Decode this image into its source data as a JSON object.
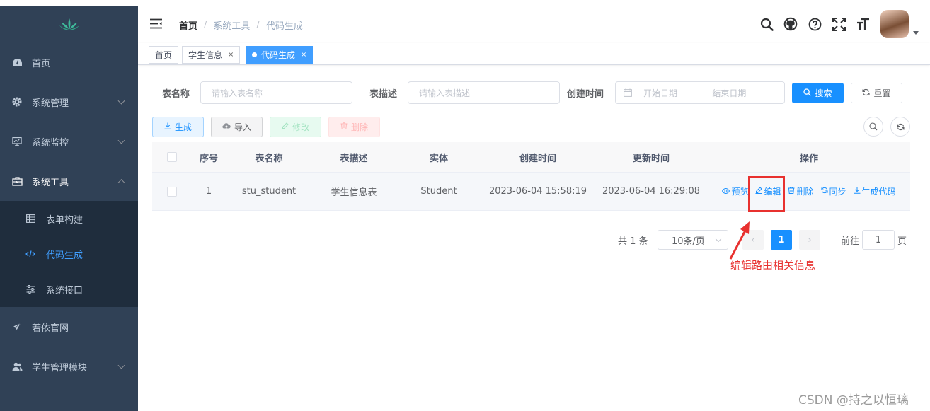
{
  "sidebar": {
    "logo_icon": "lotus-logo-icon",
    "items": [
      {
        "label": "首页",
        "icon": "dashboard-icon"
      },
      {
        "label": "系统管理",
        "icon": "gear-icon"
      },
      {
        "label": "系统监控",
        "icon": "monitor-icon"
      },
      {
        "label": "系统工具",
        "icon": "toolbox-icon"
      },
      {
        "label": "若依官网",
        "icon": "paper-plane-icon"
      },
      {
        "label": "学生管理模块",
        "icon": "users-icon"
      }
    ],
    "submenu": [
      {
        "label": "表单构建",
        "icon": "form-grid-icon"
      },
      {
        "label": "代码生成",
        "icon": "code-icon",
        "active": true
      },
      {
        "label": "系统接口",
        "icon": "sliders-icon"
      }
    ]
  },
  "breadcrumb": [
    "首页",
    "系统工具",
    "代码生成"
  ],
  "tags": [
    {
      "label": "首页"
    },
    {
      "label": "学生信息",
      "close": "×"
    },
    {
      "label": "代码生成",
      "close": "×",
      "active": true
    }
  ],
  "search": {
    "table_name_label": "表名称",
    "table_name_placeholder": "请输入表名称",
    "table_desc_label": "表描述",
    "table_desc_placeholder": "请输入表描述",
    "created_label": "创建时间",
    "start_placeholder": "开始日期",
    "range_sep": "-",
    "end_placeholder": "结束日期",
    "search_label": "搜索",
    "reset_label": "重置"
  },
  "toolbar": {
    "generate": "生成",
    "import": "导入",
    "edit": "修改",
    "delete": "删除"
  },
  "table": {
    "headers": [
      "序号",
      "表名称",
      "表描述",
      "实体",
      "创建时间",
      "更新时间",
      "操作"
    ],
    "rows": [
      {
        "index": "1",
        "table_name": "stu_student",
        "table_desc": "学生信息表",
        "entity": "Student",
        "created": "2023-06-04 15:58:19",
        "updated": "2023-06-04 16:29:08",
        "ops": [
          "预览",
          "编辑",
          "删除",
          "同步",
          "生成代码"
        ]
      }
    ]
  },
  "pagination": {
    "total": "共 1 条",
    "page_size": "10条/页",
    "current": "1",
    "goto_prefix": "前往",
    "goto_value": "1",
    "goto_suffix": "页"
  },
  "annotation": {
    "text": "编辑路由相关信息",
    "color": "#e8312f"
  },
  "watermark": "CSDN @持之以恒璃",
  "colors": {
    "sidebar_bg": "#304156",
    "submenu_bg": "#1f2d3d",
    "primary": "#1890ff"
  }
}
